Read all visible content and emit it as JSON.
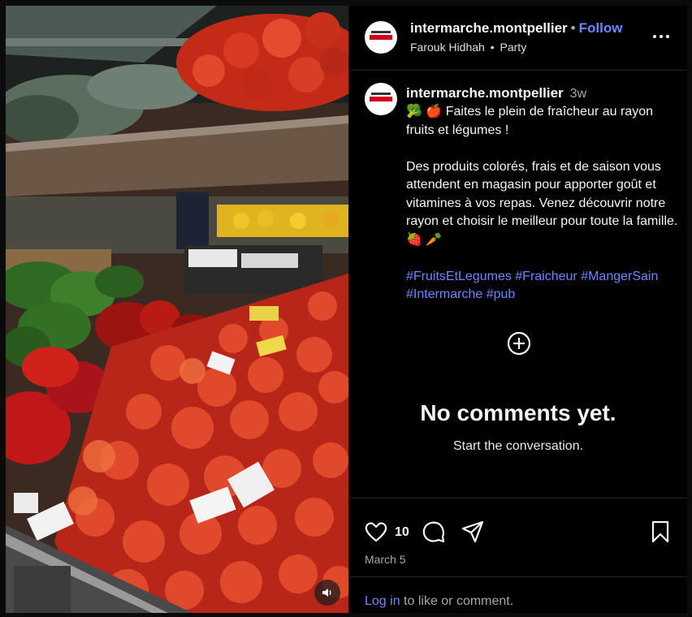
{
  "post": {
    "username": "intermarche.montpellier",
    "follow_separator": "•",
    "follow_label": "Follow",
    "audio_artist": "Farouk Hidhah",
    "audio_separator": "•",
    "audio_title": "Party",
    "more_icon": "more-horizontal-icon"
  },
  "caption": {
    "username": "intermarche.montpellier",
    "time_ago": "3w",
    "text": "🥦 🍎 Faites le plein de fraîcheur au rayon fruits et légumes !\n\nDes produits colorés, frais et de saison vous attendent en magasin pour apporter goût et vitamines à vos repas. Venez découvrir notre rayon et choisir le meilleur pour toute la famille. 🍓 🥕\n\n",
    "hashtags": "#FruitsEtLegumes #Fraicheur #MangerSain #Intermarche #pub"
  },
  "comments": {
    "empty_title": "No comments yet.",
    "empty_subtitle": "Start the conversation."
  },
  "actions": {
    "like_count": "10",
    "date": "March 5",
    "login_link": "Log in",
    "login_rest": " to like or comment."
  },
  "colors": {
    "accent": "#6c86ff",
    "background": "#000000",
    "divider": "#262626",
    "muted_text": "#a8a8a8"
  }
}
